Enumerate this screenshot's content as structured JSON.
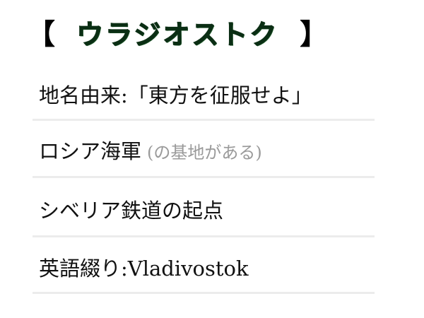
{
  "title": {
    "open_bracket": "【",
    "text": "ウラジオストク",
    "close_bracket": "】",
    "color": "#0b2e14"
  },
  "items": [
    {
      "main": "地名由来:「東方を征服せよ」",
      "note": ""
    },
    {
      "main": "ロシア海軍",
      "note": "(の基地がある)"
    },
    {
      "main": "シベリア鉄道の起点",
      "note": ""
    },
    {
      "main": "英語綴り:Vladivostok",
      "note": ""
    }
  ]
}
